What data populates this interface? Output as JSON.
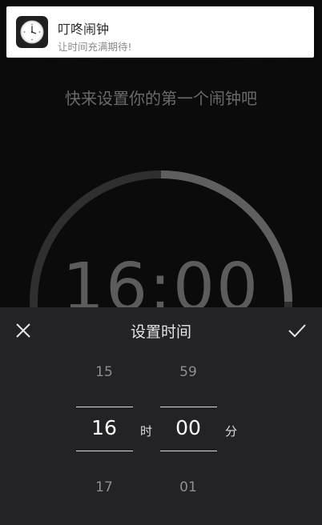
{
  "notification": {
    "title": "叮咚闹钟",
    "subtitle": "让时间充满期待!",
    "icon": "clock-icon"
  },
  "main": {
    "hint": "快来设置你的第一个闹钟吧",
    "time_display": "16:00"
  },
  "picker": {
    "title": "设置时间",
    "close_icon": "close-icon",
    "confirm_icon": "check-icon",
    "hour": {
      "prev": "15",
      "selected": "16",
      "next": "17",
      "unit": "时"
    },
    "minute": {
      "prev": "59",
      "selected": "00",
      "next": "01",
      "unit": "分"
    }
  },
  "colors": {
    "background": "#0b0b0b",
    "sheet": "#232326",
    "ring_track": "#2f2f2f",
    "ring_progress": "#5f5f5f"
  }
}
